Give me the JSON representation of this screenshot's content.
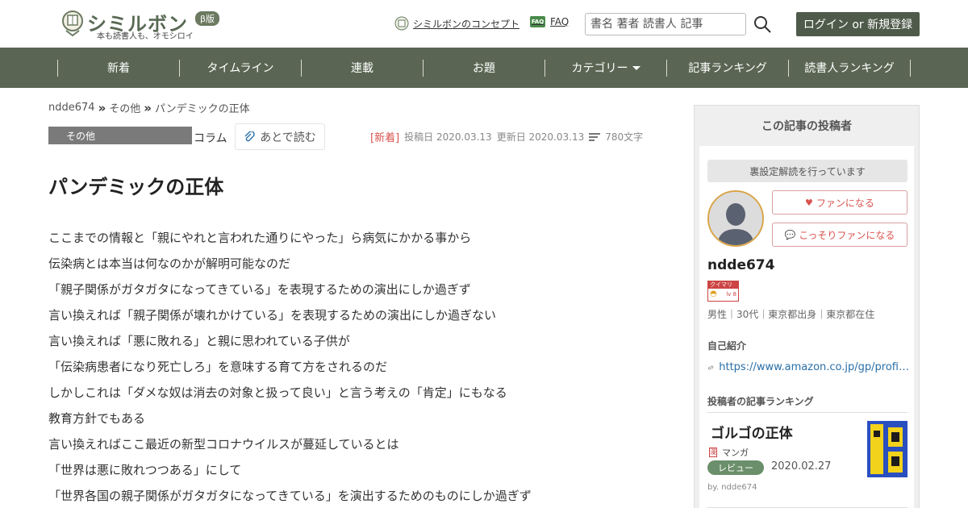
{
  "header": {
    "logo_text": "シミルボン",
    "logo_beta": "β版",
    "logo_sub": "本も読書人も、オモシロイ",
    "concept_link": "シミルボンのコンセプト",
    "faq_link": "FAQ",
    "faq_icon_text": "FAQ",
    "search_placeholder": "書名 著者 読書人 記事",
    "login_label": "ログイン or 新規登録"
  },
  "nav": {
    "items": [
      "新着",
      "タイムライン",
      "連載",
      "お題",
      "カテゴリー",
      "記事ランキング",
      "読書人ランキング"
    ]
  },
  "breadcrumb": [
    "ndde674",
    "その他",
    "パンデミックの正体"
  ],
  "article": {
    "category": "その他",
    "type": "コラム",
    "read_later": "あとで読む",
    "new_tag": "[新着]",
    "posted": "投稿日 2020.03.13",
    "updated": "更新日 2020.03.13",
    "length": "780文字",
    "title": "パンデミックの正体",
    "lines": [
      "ここまでの情報と「親にやれと言われた通りにやった」ら病気にかかる事から",
      "伝染病とは本当は何なのかが解明可能なのだ",
      "「親子関係がガタガタになってきている」を表現するための演出にしか過ぎず",
      "言い換えれば「親子関係が壊れかけている」を表現するための演出にしか過ぎない",
      "言い換えれば「悪に敗れる」と親に思われている子供が",
      "「伝染病患者になり死亡しろ」を意味する育て方をされるのだ",
      "しかしこれは「ダメな奴は消去の対象と扱って良い」と言う考えの「肯定」にもなる",
      "教育方針でもある",
      "言い換えればここ最近の新型コロナウイルスが蔓延しているとは",
      "「世界は悪に敗れつつある」にして",
      "「世界各国の親子関係がガタガタになってきている」を演出するためのものにしか過ぎず"
    ]
  },
  "sidebar": {
    "heading": "この記事の投稿者",
    "notice": "裏設定解読を行っています",
    "fan_button": "ファンになる",
    "secret_fan_button": "こっそりファンになる",
    "author_name": "ndde674",
    "badge_text": "クイマリ",
    "badge_level": "lv 8",
    "author_info": "男性｜30代｜東京都出身｜東京都在住",
    "intro_label": "自己紹介",
    "intro_link": "https://www.amazon.co.jp/gp/profi…",
    "ranking_label": "投稿者の記事ランキング",
    "ranking": {
      "title": "ゴルゴの正体",
      "category": "マンガ",
      "tag": "レビュー",
      "date": "2020.02.27",
      "by": "by. ndde674"
    }
  },
  "colors": {
    "nav_bg": "#5a6653",
    "login_bg": "#4f5b4a",
    "new_tag": "#d9534f",
    "fan_accent": "#d9534f",
    "review_pill": "#6b8f6b"
  }
}
